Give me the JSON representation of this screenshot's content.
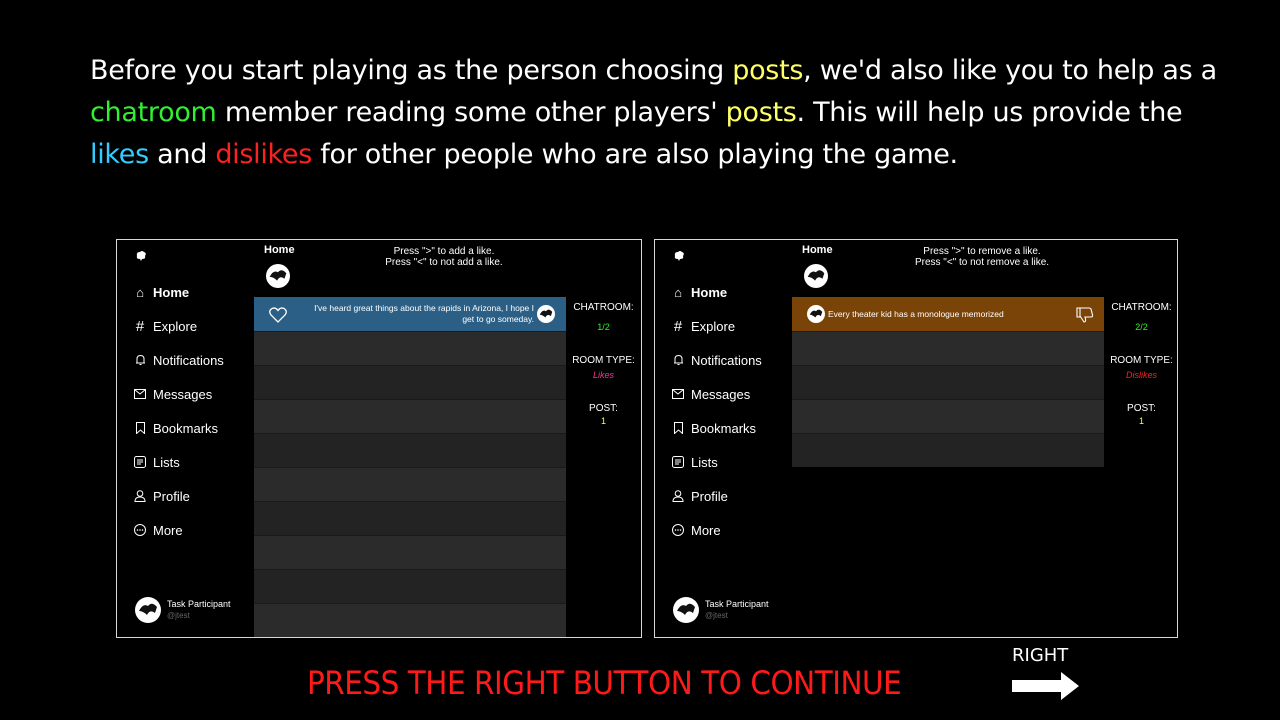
{
  "intro": {
    "p1": "Before you start playing as the person choosing ",
    "posts1": "posts",
    "p2": ", we'd also like you to help as a ",
    "chatroom": "chatroom",
    "p3": " member reading some other players' ",
    "posts2": "posts",
    "p4": ". This will help us provide the ",
    "likes": "likes",
    "p5": " and ",
    "dislikes": "dislikes",
    "p6": " for other people who are also playing the game."
  },
  "colors": {
    "yellow": "#ffff66",
    "green": "#33ee33",
    "cyan": "#33ccff",
    "red": "#ff2020",
    "post_blue": "#2b5f86",
    "post_brown": "#7a4408",
    "row_a": "#2b2b2b",
    "row_b": "#232323"
  },
  "sidebar": {
    "items": [
      {
        "icon": "home-icon",
        "label": "Home"
      },
      {
        "icon": "hashtag-icon",
        "label": "Explore"
      },
      {
        "icon": "bell-icon",
        "label": "Notifications"
      },
      {
        "icon": "envelope-icon",
        "label": "Messages"
      },
      {
        "icon": "bookmark-icon",
        "label": "Bookmarks"
      },
      {
        "icon": "list-icon",
        "label": "Lists"
      },
      {
        "icon": "person-icon",
        "label": "Profile"
      },
      {
        "icon": "more-icon",
        "label": "More"
      }
    ],
    "user_name": "Task Participant",
    "user_handle": "@jtest"
  },
  "panel_left": {
    "feed_title": "Home",
    "instr_line1": "Press \">\" to add a like.",
    "instr_line2": "Press \"<\" to not add a like.",
    "post_text": "I've heard great things about the rapids in Arizona, I hope I get to go someday.",
    "chatroom_label": "CHATROOM:",
    "chatroom_value": "1/2",
    "room_type_label": "ROOM TYPE:",
    "room_type_value": "Likes",
    "post_label": "POST:",
    "post_value": "1"
  },
  "panel_right": {
    "feed_title": "Home",
    "instr_line1": "Press \">\" to remove a like.",
    "instr_line2": "Press \"<\" to not remove a like.",
    "post_text": "Every theater kid has a monologue memorized",
    "chatroom_label": "CHATROOM:",
    "chatroom_value": "2/2",
    "room_type_label": "ROOM TYPE:",
    "room_type_value": "Dislikes",
    "post_label": "POST:",
    "post_value": "1"
  },
  "footer": {
    "press_text": "PRESS THE RIGHT BUTTON TO CONTINUE",
    "right_label": "RIGHT"
  }
}
